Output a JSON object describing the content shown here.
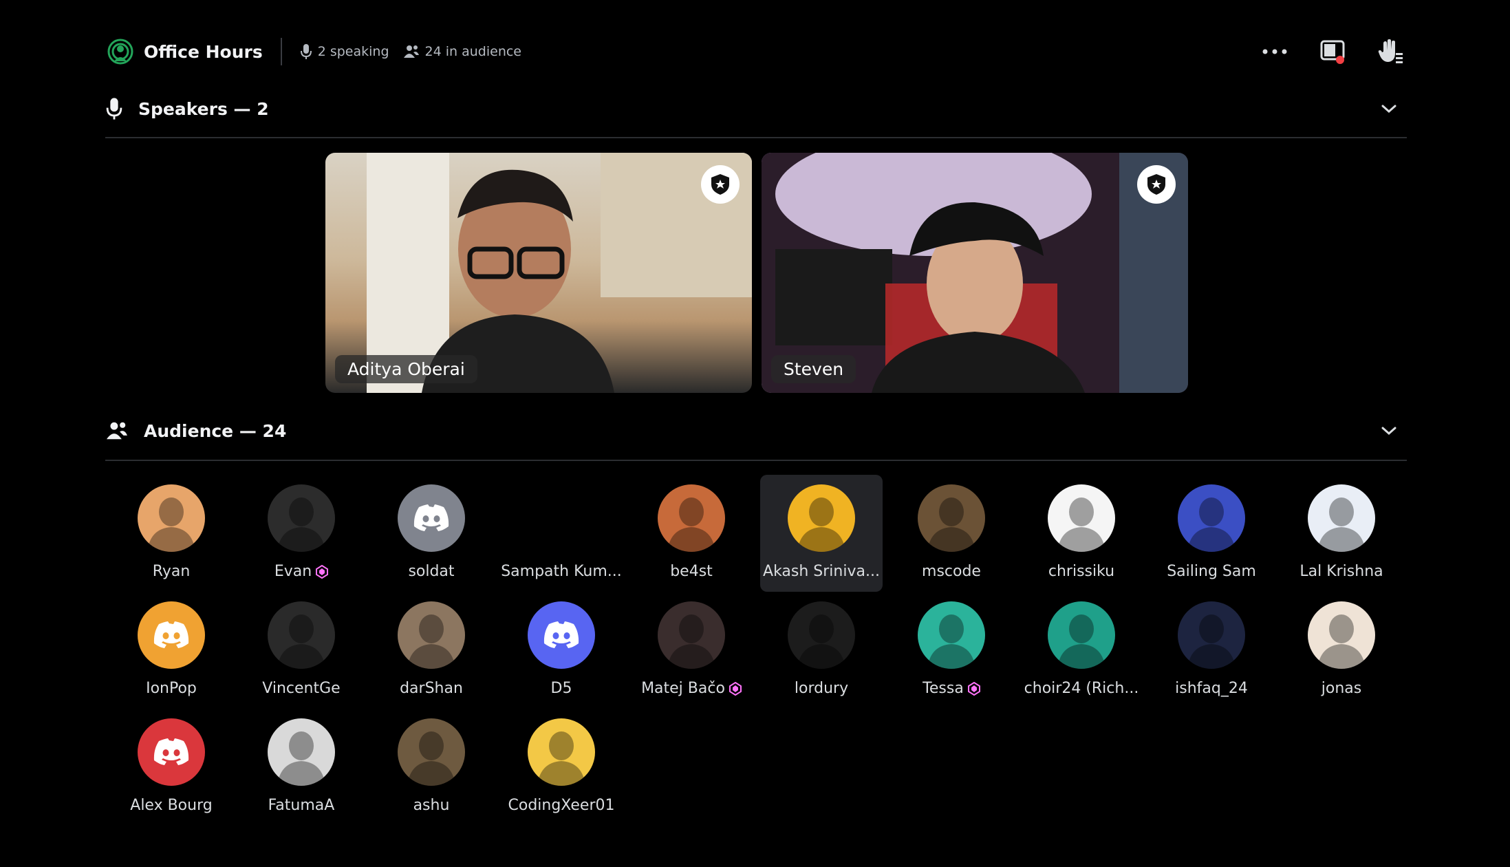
{
  "header": {
    "title": "Office Hours",
    "speaking": "2 speaking",
    "audience_count": "24 in audience",
    "actions": [
      "more-icon",
      "popout-icon",
      "raise-hand-icon"
    ]
  },
  "speakers": {
    "label": "Speakers — 2",
    "tiles": [
      {
        "name": "Aditya Oberai"
      },
      {
        "name": "Steven"
      }
    ]
  },
  "audience": {
    "label": "Audience — 24",
    "members": [
      {
        "name": "Ryan",
        "color": "#e7a56a",
        "boost": false
      },
      {
        "name": "Evan",
        "color": "#2c2c2c",
        "boost": true
      },
      {
        "name": "soldat",
        "color": "#80848e",
        "boost": false
      },
      {
        "name": "Sampath Kum...",
        "color": "#000000",
        "boost": false
      },
      {
        "name": "be4st",
        "color": "#c76a3a",
        "boost": false
      },
      {
        "name": "Akash Sriniva...",
        "color": "#f0b323",
        "boost": false,
        "selected": true
      },
      {
        "name": "mscode",
        "color": "#6b5236",
        "boost": false
      },
      {
        "name": "chrissiku",
        "color": "#f5f5f5",
        "boost": false
      },
      {
        "name": "Sailing Sam",
        "color": "#3b4fc4",
        "boost": false
      },
      {
        "name": "Lal Krishna",
        "color": "#e9eef6",
        "boost": false
      },
      {
        "name": "IonPop",
        "color": "#f0a232",
        "boost": false
      },
      {
        "name": "VincentGe",
        "color": "#2a2a2a",
        "boost": false
      },
      {
        "name": "darShan",
        "color": "#8c7660",
        "boost": false
      },
      {
        "name": "D5",
        "color": "#5865f2",
        "boost": false
      },
      {
        "name": "Matej Bačo",
        "color": "#3a2d2d",
        "boost": true
      },
      {
        "name": "lordury",
        "color": "#1c1c1c",
        "boost": false
      },
      {
        "name": "Tessa",
        "color": "#2bb39b",
        "boost": true
      },
      {
        "name": "choir24 (Rich...",
        "color": "#1fa08a",
        "boost": false
      },
      {
        "name": "ishfaq_24",
        "color": "#1d2440",
        "boost": false
      },
      {
        "name": "jonas",
        "color": "#efe3d6",
        "boost": false
      },
      {
        "name": "Alex Bourg",
        "color": "#da373c",
        "boost": false
      },
      {
        "name": "FatumaA",
        "color": "#d9d9d9",
        "boost": false
      },
      {
        "name": "ashu",
        "color": "#6e5a40",
        "boost": false
      },
      {
        "name": "CodingXeer01",
        "color": "#f3c846",
        "boost": false
      }
    ]
  },
  "colors": {
    "accent_green": "#23a55a",
    "boost_pink": "#ff73fa",
    "background": "#000000"
  }
}
